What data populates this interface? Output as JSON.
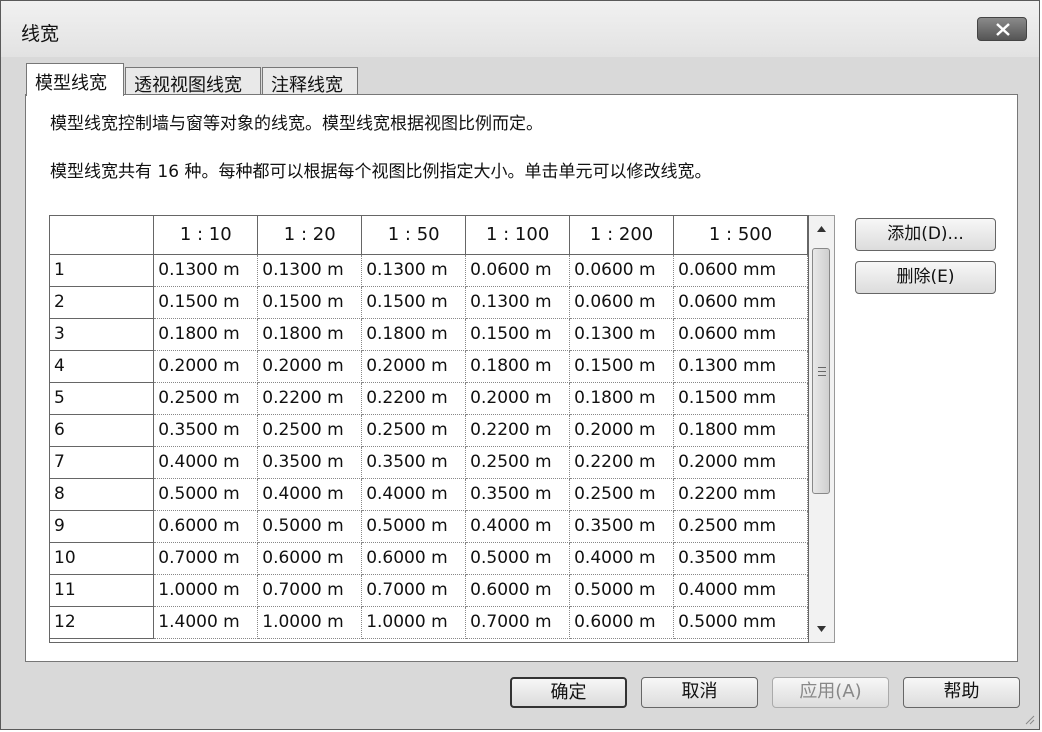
{
  "window": {
    "title": "线宽"
  },
  "tabs": [
    {
      "label": "模型线宽",
      "active": true
    },
    {
      "label": "透视视图线宽",
      "active": false
    },
    {
      "label": "注释线宽",
      "active": false
    }
  ],
  "description": {
    "line1": "模型线宽控制墙与窗等对象的线宽。模型线宽根据视图比例而定。",
    "line2": "模型线宽共有 16 种。每种都可以根据每个视图比例指定大小。单击单元可以修改线宽。"
  },
  "table": {
    "columns": [
      "1 : 10",
      "1 : 20",
      "1 : 50",
      "1 : 100",
      "1 : 200",
      "1 : 500"
    ],
    "rows": [
      {
        "id": "1",
        "values": [
          "0.1300 m",
          "0.1300 m",
          "0.1300 m",
          "0.0600 m",
          "0.0600 m",
          "0.0600 mm"
        ]
      },
      {
        "id": "2",
        "values": [
          "0.1500 m",
          "0.1500 m",
          "0.1500 m",
          "0.1300 m",
          "0.0600 m",
          "0.0600 mm"
        ]
      },
      {
        "id": "3",
        "values": [
          "0.1800 m",
          "0.1800 m",
          "0.1800 m",
          "0.1500 m",
          "0.1300 m",
          "0.0600 mm"
        ]
      },
      {
        "id": "4",
        "values": [
          "0.2000 m",
          "0.2000 m",
          "0.2000 m",
          "0.1800 m",
          "0.1500 m",
          "0.1300 mm"
        ]
      },
      {
        "id": "5",
        "values": [
          "0.2500 m",
          "0.2200 m",
          "0.2200 m",
          "0.2000 m",
          "0.1800 m",
          "0.1500 mm"
        ]
      },
      {
        "id": "6",
        "values": [
          "0.3500 m",
          "0.2500 m",
          "0.2500 m",
          "0.2200 m",
          "0.2000 m",
          "0.1800 mm"
        ]
      },
      {
        "id": "7",
        "values": [
          "0.4000 m",
          "0.3500 m",
          "0.3500 m",
          "0.2500 m",
          "0.2200 m",
          "0.2000 mm"
        ]
      },
      {
        "id": "8",
        "values": [
          "0.5000 m",
          "0.4000 m",
          "0.4000 m",
          "0.3500 m",
          "0.2500 m",
          "0.2200 mm"
        ]
      },
      {
        "id": "9",
        "values": [
          "0.6000 m",
          "0.5000 m",
          "0.5000 m",
          "0.4000 m",
          "0.3500 m",
          "0.2500 mm"
        ]
      },
      {
        "id": "10",
        "values": [
          "0.7000 m",
          "0.6000 m",
          "0.6000 m",
          "0.5000 m",
          "0.4000 m",
          "0.3500 mm"
        ]
      },
      {
        "id": "11",
        "values": [
          "1.0000 m",
          "0.7000 m",
          "0.7000 m",
          "0.6000 m",
          "0.5000 m",
          "0.4000 mm"
        ]
      },
      {
        "id": "12",
        "values": [
          "1.4000 m",
          "1.0000 m",
          "1.0000 m",
          "0.7000 m",
          "0.6000 m",
          "0.5000 mm"
        ]
      }
    ]
  },
  "side_buttons": {
    "add": "添加(D)...",
    "delete": "删除(E)"
  },
  "footer": {
    "ok": "确定",
    "cancel": "取消",
    "apply": "应用(A)",
    "help": "帮助"
  },
  "icons": {
    "close": "close-icon",
    "scroll_up": "scroll-up-icon",
    "scroll_down": "scroll-down-icon"
  }
}
